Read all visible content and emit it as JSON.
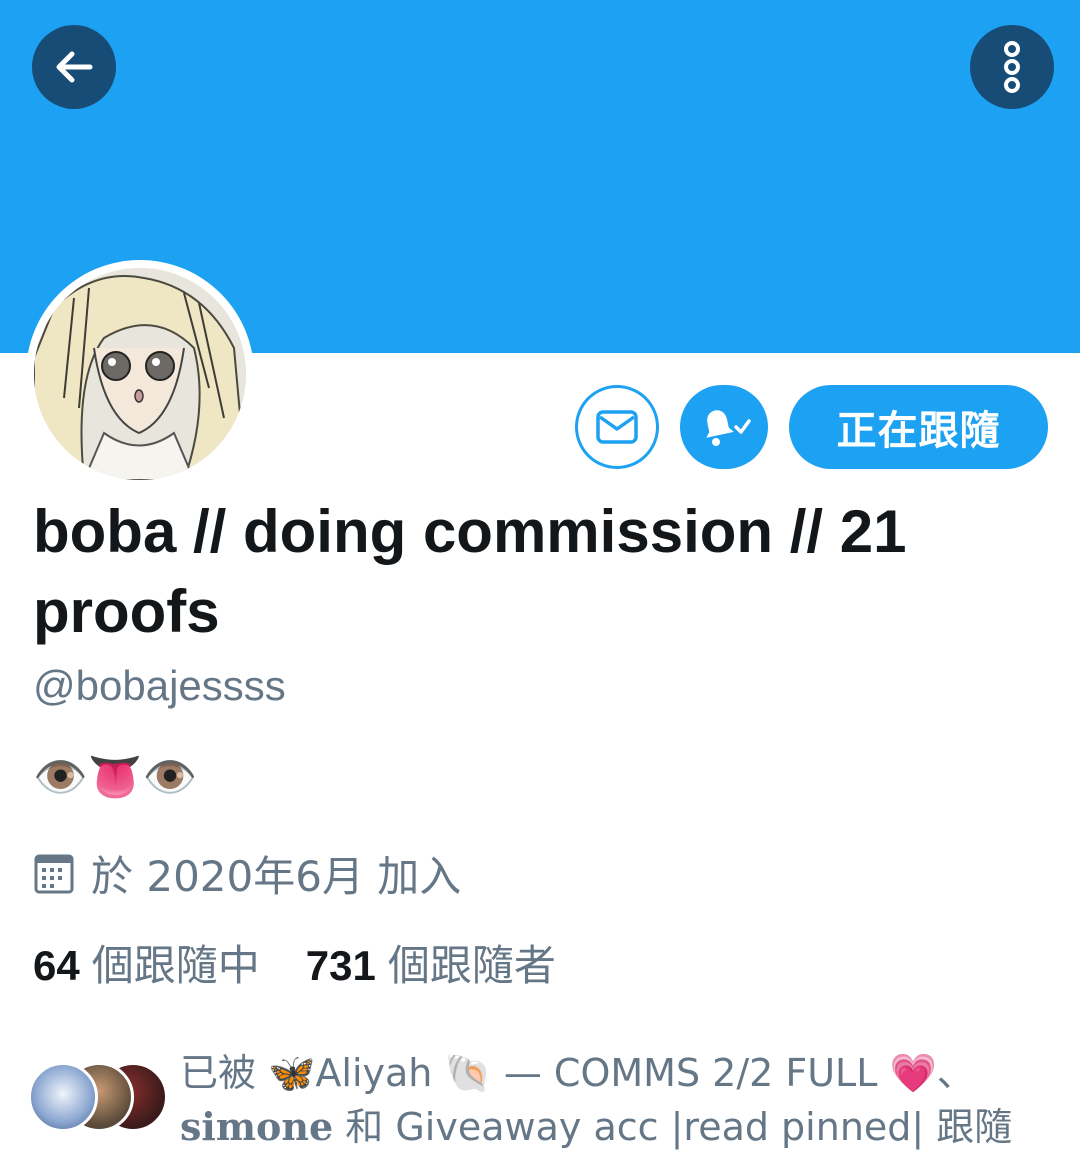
{
  "header": {
    "back_icon": "arrow-left-icon",
    "more_icon": "more-vertical-icon",
    "banner_color": "#1da1f2"
  },
  "profile": {
    "display_name": "boba // doing commission // 21 proofs",
    "handle": "@bobajessss",
    "bio": "👁️👅👁️",
    "joined": "於 2020年6月 加入",
    "following_count": "64",
    "following_label": "個跟隨中",
    "followers_count": "731",
    "followers_label": "個跟隨者"
  },
  "actions": {
    "message_icon": "mail-icon",
    "notify_icon": "bell-check-icon",
    "follow_label": "正在跟隨"
  },
  "followed_by": {
    "prefix": "已被 ",
    "name1": "🦋Aliyah 🐚 — COMMS 2/2 FULL 💗",
    "sep": "、",
    "name2": "𝐬𝐢𝐦𝐨𝐧𝐞",
    "and": " 和 ",
    "name3": "Giveaway acc |read pinned|",
    "suffix": " 跟隨"
  },
  "colors": {
    "accent": "#1da1f2",
    "dark_button": "#174c76",
    "secondary_text": "#657786",
    "primary_text": "#14171a"
  }
}
